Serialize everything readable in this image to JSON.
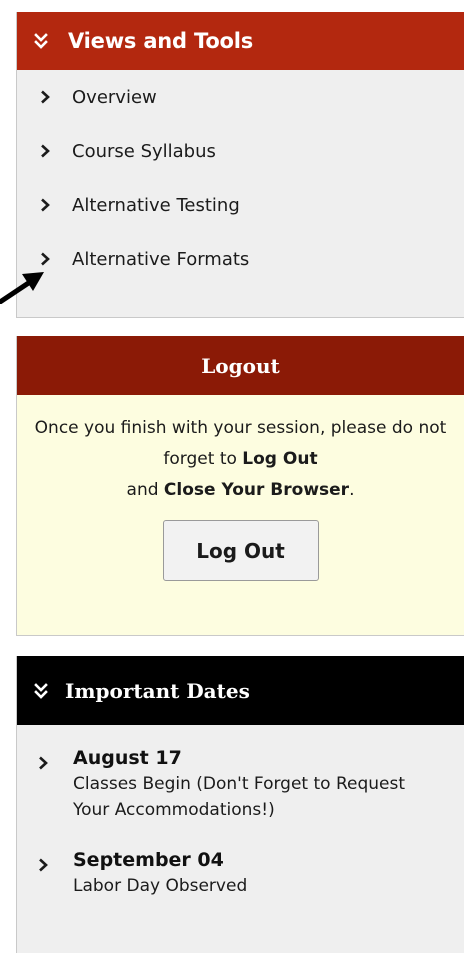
{
  "views_tools": {
    "title": "Views and Tools",
    "items": [
      {
        "label": "Overview"
      },
      {
        "label": "Course Syllabus"
      },
      {
        "label": "Alternative Testing"
      },
      {
        "label": "Alternative Formats"
      }
    ]
  },
  "logout": {
    "title": "Logout",
    "text_part1": "Once you finish with your session, please do not forget to ",
    "text_bold1": "Log Out",
    "text_part2": " and ",
    "text_bold2": "Close Your Browser",
    "text_part3": ".",
    "button_label": "Log Out"
  },
  "important_dates": {
    "title": "Important Dates",
    "entries": [
      {
        "date": "August 17",
        "description": "Classes Begin (Don't Forget to Request Your Accommodations!)"
      },
      {
        "date": "September 04",
        "description": "Labor Day Observed"
      }
    ]
  },
  "colors": {
    "views_header": "#b3280f",
    "logout_header": "#8b1a06",
    "logout_body": "#fdfde0",
    "dates_header": "#000000",
    "panel_bg": "#efefef"
  }
}
